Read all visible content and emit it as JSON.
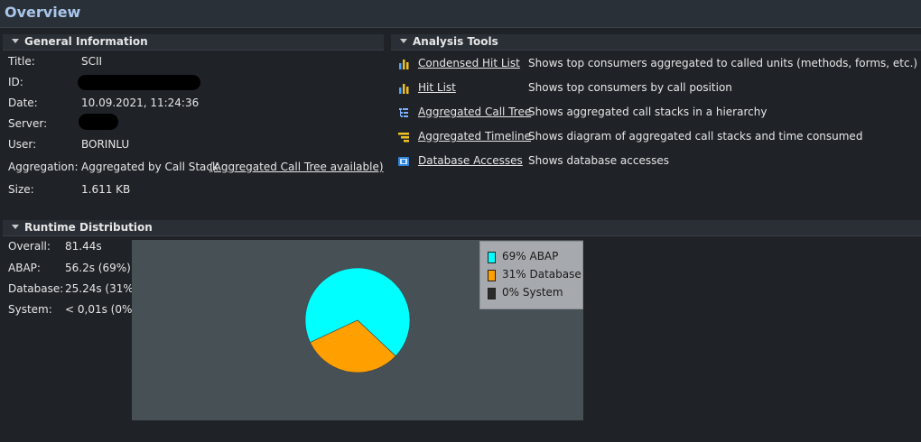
{
  "window": {
    "title": "Overview"
  },
  "general": {
    "header": "General Information",
    "title_label": "Title:",
    "title_value": "SCII",
    "id_label": "ID:",
    "date_label": "Date:",
    "date_value": "10.09.2021, 11:24:36",
    "server_label": "Server:",
    "user_label": "User:",
    "user_value": "BORINLU",
    "aggregation_label": "Aggregation:",
    "aggregation_value": "Aggregated by Call Stack",
    "aggregation_link": "(Aggregated Call Tree available)",
    "size_label": "Size:",
    "size_value": "1.611 KB"
  },
  "analysis": {
    "header": "Analysis Tools",
    "tools": [
      {
        "name": "Condensed Hit List",
        "desc": "Shows top consumers aggregated to called units (methods, forms, etc.)",
        "icon": "bar-chart-icon"
      },
      {
        "name": "Hit List",
        "desc": "Shows top consumers by call position",
        "icon": "bar-chart-icon"
      },
      {
        "name": "Aggregated Call Tree",
        "desc": "Shows aggregated call stacks in a hierarchy",
        "icon": "tree-icon"
      },
      {
        "name": "Aggregated Timeline",
        "desc": "Shows diagram of aggregated call stacks and time consumed",
        "icon": "timeline-icon"
      },
      {
        "name": "Database Accesses",
        "desc": "Shows database accesses",
        "icon": "database-icon"
      }
    ]
  },
  "runtime": {
    "header": "Runtime Distribution",
    "overall_label": "Overall:",
    "overall_value": "81.44s",
    "abap_label": "ABAP:",
    "abap_value": "56.2s (69%)",
    "database_label": "Database:",
    "database_value": "25.24s (31%)",
    "system_label": "System:",
    "system_value": "< 0,01s (0%)"
  },
  "colors": {
    "abap": "#00ffff",
    "database": "#ff9f00",
    "system": "#2b2b2b",
    "title": "#a9c6ea"
  },
  "chart_data": {
    "type": "pie",
    "slices": [
      {
        "label": "69% ABAP",
        "value": 69,
        "color": "#00ffff"
      },
      {
        "label": "31% Database",
        "value": 31,
        "color": "#ff9f00"
      },
      {
        "label": "0% System",
        "value": 0,
        "color": "#2b2b2b"
      }
    ],
    "legend_position": "top-right"
  }
}
